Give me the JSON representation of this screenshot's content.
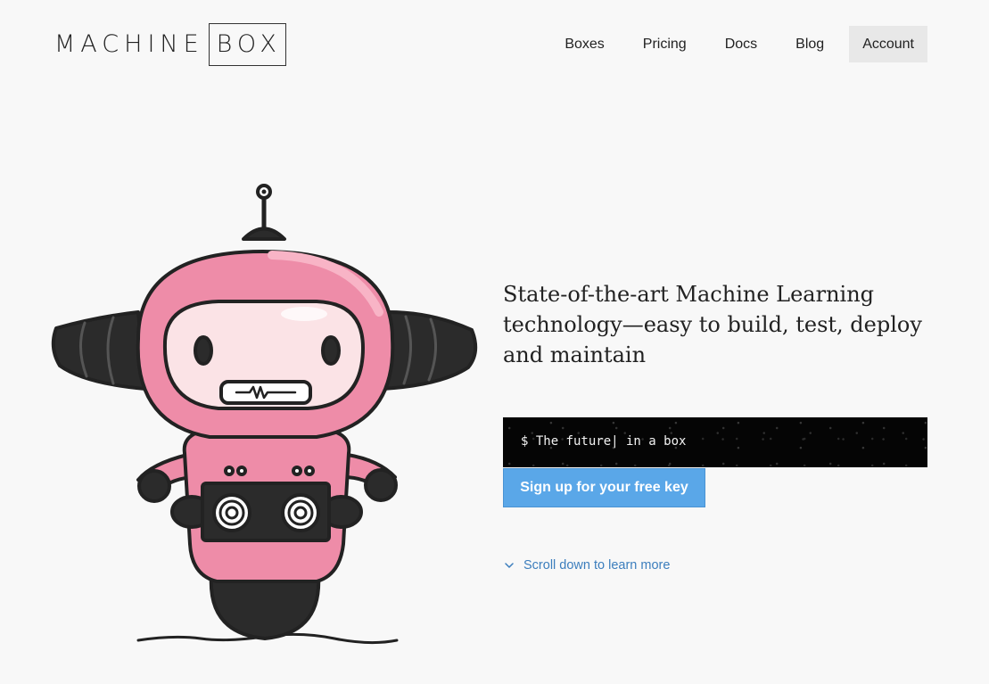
{
  "brand": {
    "name_left": "MACHINE",
    "name_boxed": "BOX"
  },
  "nav": {
    "items": [
      {
        "label": "Boxes",
        "active": false
      },
      {
        "label": "Pricing",
        "active": false
      },
      {
        "label": "Docs",
        "active": false
      },
      {
        "label": "Blog",
        "active": false
      },
      {
        "label": "Account",
        "active": true
      }
    ]
  },
  "hero": {
    "tagline": "State-of-the-art Machine Learning technology—easy to build, test, deploy and maintain",
    "terminal_text": "$ The future| in a box",
    "cta_label": "Sign up for your free key",
    "scroll_label": "Scroll down to learn more"
  },
  "colors": {
    "accent": "#5aa7e8",
    "link": "#3c7ebd",
    "robot_pink": "#ee8ca8",
    "robot_dark": "#2b2b2b"
  },
  "icons": {
    "robot": "robot-mascot-illustration",
    "scroll": "chevron-down-icon"
  }
}
